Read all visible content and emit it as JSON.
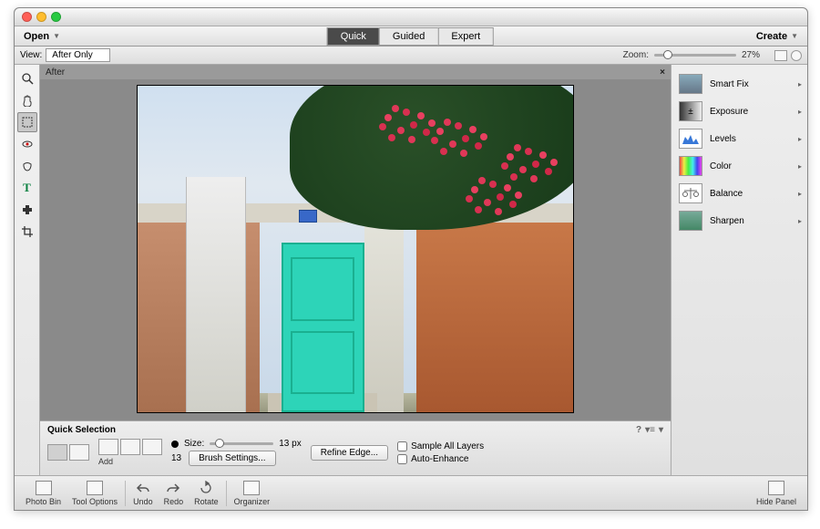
{
  "topbar": {
    "open_label": "Open",
    "create_label": "Create",
    "tabs": {
      "quick": "Quick",
      "guided": "Guided",
      "expert": "Expert"
    }
  },
  "subbar": {
    "view_label": "View:",
    "view_selected": "After Only",
    "zoom_label": "Zoom:",
    "zoom_value": "27%"
  },
  "canvas": {
    "header_label": "After"
  },
  "adjustments": {
    "items": [
      {
        "label": "Smart Fix"
      },
      {
        "label": "Exposure"
      },
      {
        "label": "Levels"
      },
      {
        "label": "Color"
      },
      {
        "label": "Balance"
      },
      {
        "label": "Sharpen"
      }
    ]
  },
  "options": {
    "title": "Quick Selection",
    "add_label": "Add",
    "size_label": "Size:",
    "size_value": "13 px",
    "size_number": "13",
    "brush_settings_label": "Brush Settings...",
    "refine_edge_label": "Refine Edge...",
    "sample_all_label": "Sample All Layers",
    "auto_enhance_label": "Auto-Enhance"
  },
  "bottombar": {
    "photo_bin": "Photo Bin",
    "tool_options": "Tool Options",
    "undo": "Undo",
    "redo": "Redo",
    "rotate": "Rotate",
    "organizer": "Organizer",
    "hide_panel": "Hide Panel"
  }
}
